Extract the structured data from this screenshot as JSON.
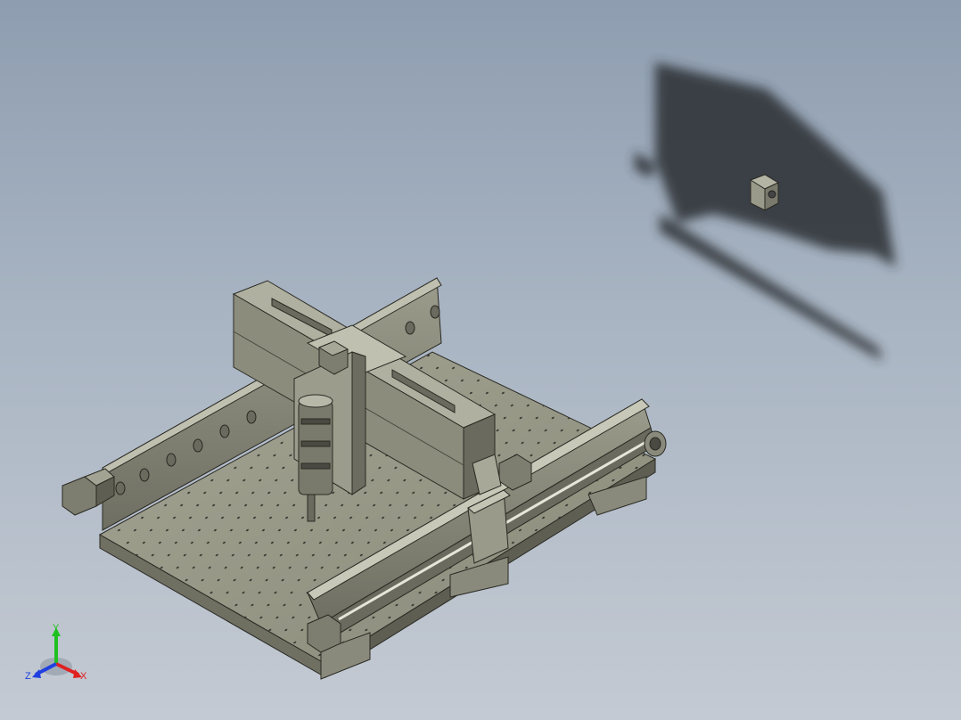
{
  "view": {
    "background_top": "#8e9db0",
    "background_bottom": "#c4cad3",
    "model_color": "#8f8f80",
    "shadow_color": "#2a2e33"
  },
  "triad": {
    "x_label": "X",
    "y_label": "Y",
    "z_label": "Z",
    "x_color": "#e02020",
    "y_color": "#20c020",
    "z_color": "#2040e0"
  },
  "model": {
    "name_icon": "cnc-router-gantry-icon",
    "parts": [
      "base-plate",
      "left-rail",
      "right-rail",
      "gantry-beam",
      "spindle",
      "stepper-motors",
      "floating-block"
    ]
  }
}
